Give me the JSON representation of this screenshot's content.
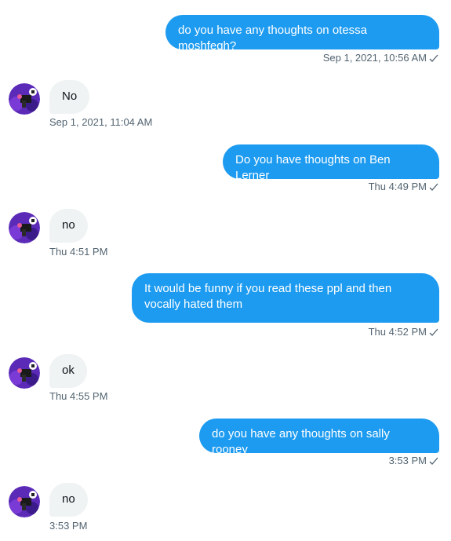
{
  "messages": [
    {
      "dir": "out",
      "text": "do you have any thoughts on otessa moshfegh?",
      "time": "Sep 1, 2021, 10:56 AM"
    },
    {
      "dir": "in",
      "text": "No",
      "time": "Sep 1, 2021, 11:04 AM"
    },
    {
      "dir": "out",
      "text": "Do you have thoughts on Ben Lerner",
      "time": "Thu 4:49 PM"
    },
    {
      "dir": "in",
      "text": "no",
      "time": "Thu 4:51 PM"
    },
    {
      "dir": "out",
      "text": "It would be funny if you read these ppl and then vocally hated them",
      "time": "Thu 4:52 PM"
    },
    {
      "dir": "in",
      "text": "ok",
      "time": "Thu 4:55 PM"
    },
    {
      "dir": "out",
      "text": "do you have any thoughts on sally rooney",
      "time": "3:53 PM"
    },
    {
      "dir": "in",
      "text": "no",
      "time": "3:53 PM"
    }
  ],
  "icons": {
    "sent_status": "checkmark-icon",
    "avatar": "avatar"
  },
  "colors": {
    "outgoing_bubble": "#1d9bf0",
    "incoming_bubble": "#eff3f4",
    "timestamp": "#536471"
  }
}
